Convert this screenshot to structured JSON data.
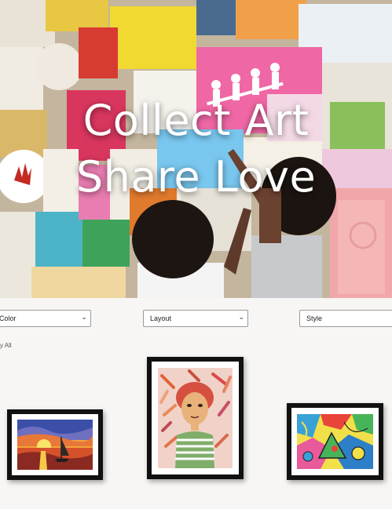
{
  "hero": {
    "title_line1": "Collect Art",
    "title_line2": "Share Love"
  },
  "filters": {
    "color": {
      "selected": "Color"
    },
    "layout": {
      "selected": "Layout"
    },
    "style": {
      "selected": "Style"
    }
  },
  "view_all_label": "y All",
  "artworks": [
    {
      "subject": "sunset-sailboat-painting"
    },
    {
      "subject": "child-portrait-painting"
    },
    {
      "subject": "colorful-abstract-painting"
    }
  ]
}
